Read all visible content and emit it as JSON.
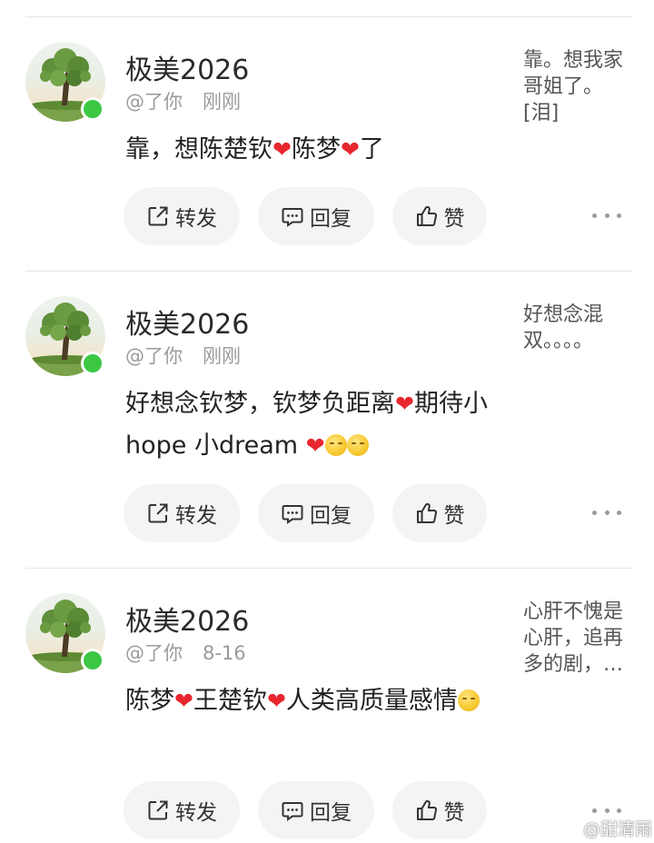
{
  "comments": [
    {
      "username": "极美2026",
      "handle": "@了你",
      "time": "刚刚",
      "content": [
        {
          "t": "text",
          "v": "靠，想陈楚钦"
        },
        {
          "t": "heart",
          "v": "❤"
        },
        {
          "t": "text",
          "v": "陈梦"
        },
        {
          "t": "heart",
          "v": "❤"
        },
        {
          "t": "text",
          "v": "了"
        }
      ],
      "side_text": "靠。想我家哥姐了。[泪]"
    },
    {
      "username": "极美2026",
      "handle": "@了你",
      "time": "刚刚",
      "content": [
        {
          "t": "text",
          "v": "好想念钦梦，钦梦负距离"
        },
        {
          "t": "heart",
          "v": "❤"
        },
        {
          "t": "text",
          "v": "期待小hope 小dream "
        },
        {
          "t": "heart",
          "v": "❤"
        },
        {
          "t": "emoji",
          "v": "shy-emoji"
        },
        {
          "t": "emoji",
          "v": "smile-emoji"
        }
      ],
      "side_text": "好想念混双。。。。"
    },
    {
      "username": "极美2026",
      "handle": "@了你",
      "time": "8-16",
      "content": [
        {
          "t": "text",
          "v": "陈梦"
        },
        {
          "t": "heart",
          "v": "❤"
        },
        {
          "t": "text",
          "v": "王楚钦"
        },
        {
          "t": "heart",
          "v": "❤"
        },
        {
          "t": "text",
          "v": "人类高质量感情"
        },
        {
          "t": "emoji",
          "v": "smile-emoji"
        }
      ],
      "side_text": "心肝不愧是心肝，追再多的剧，…"
    }
  ],
  "actions": {
    "forward_label": "转发",
    "reply_label": "回复",
    "like_label": "赞"
  },
  "watermark": "@甜清雨",
  "colors": {
    "online": "#3bc744",
    "heart": "#e8262d",
    "button_bg": "#f4f4f4"
  }
}
